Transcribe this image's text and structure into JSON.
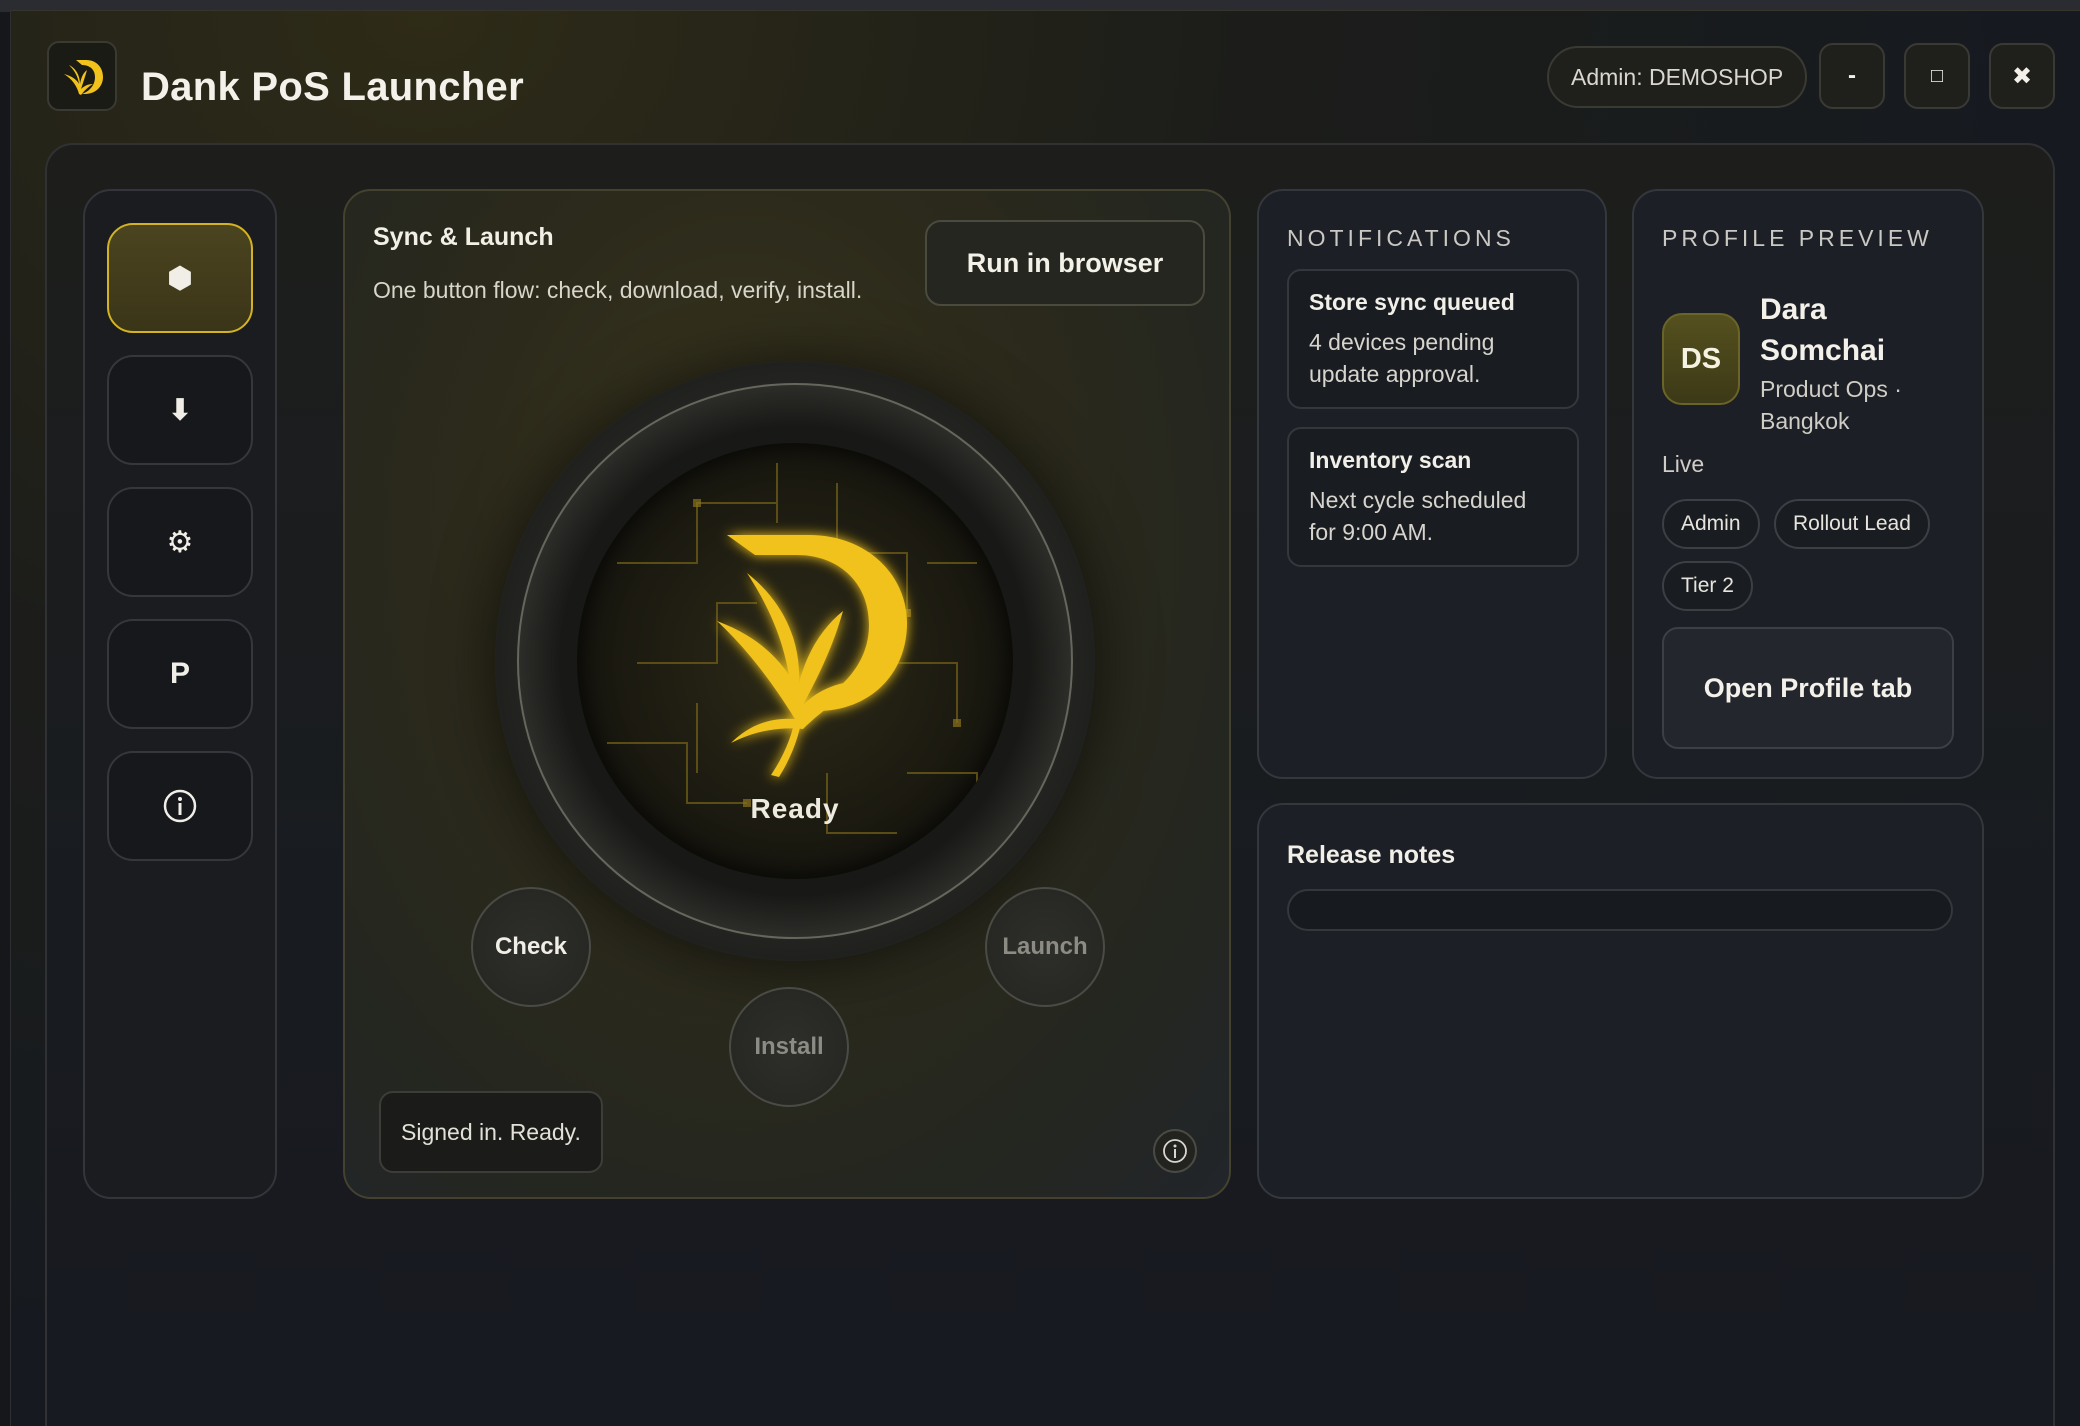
{
  "app": {
    "title": "Dank PoS Launcher",
    "admin_label": "Admin: DEMOSHOP",
    "window_controls": {
      "minimize": "-",
      "maximize": "□",
      "close": "✖"
    },
    "accent_color": "#f1c21b"
  },
  "rail": {
    "items": [
      {
        "icon": "hexagon-icon",
        "glyph": "⬢",
        "active": true
      },
      {
        "icon": "download-icon",
        "glyph": "⬇",
        "active": false
      },
      {
        "icon": "gear-icon",
        "glyph": "⚙",
        "active": false
      },
      {
        "icon": "profile-p-icon",
        "glyph": "P",
        "active": false
      },
      {
        "icon": "info-icon",
        "glyph": "ⓘ",
        "active": false
      }
    ]
  },
  "sync": {
    "title": "Sync & Launch",
    "subtitle": "One button flow: check, download, verify, install.",
    "run_browser": "Run in browser",
    "status_label": "Ready",
    "steps": {
      "check": "Check",
      "install": "Install",
      "launch": "Launch"
    },
    "status_message": "Signed in. Ready."
  },
  "notifications": {
    "heading": "NOTIFICATIONS",
    "items": [
      {
        "title": "Store sync queued",
        "body": "4 devices pending update approval."
      },
      {
        "title": "Inventory scan",
        "body": "Next cycle scheduled for 9:00 AM."
      }
    ]
  },
  "profile": {
    "heading": "PROFILE PREVIEW",
    "initials": "DS",
    "name": "Dara Somchai",
    "role": "Product Ops · Bangkok",
    "status": "Live",
    "tags": [
      "Admin",
      "Rollout Lead",
      "Tier 2"
    ],
    "open_button": "Open Profile tab"
  },
  "release_notes": {
    "title": "Release notes"
  }
}
